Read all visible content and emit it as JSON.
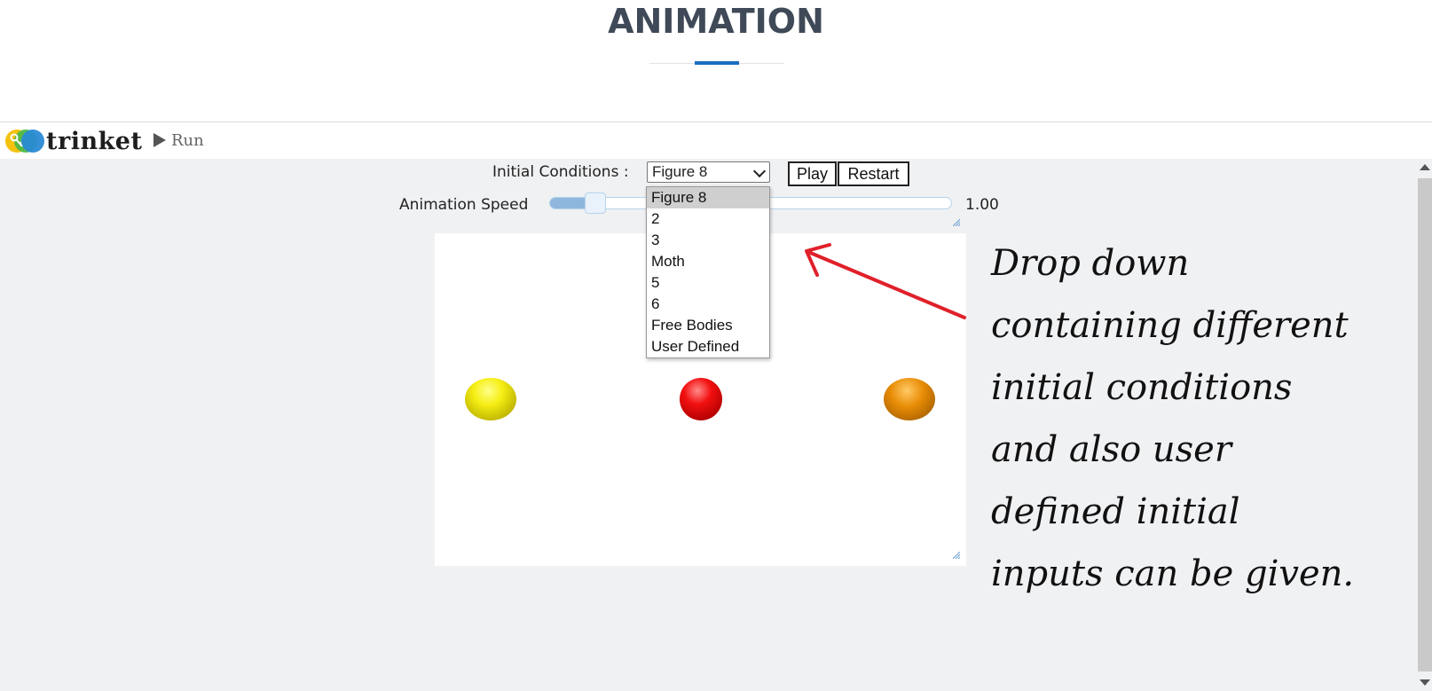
{
  "page": {
    "title": "ANIMATION"
  },
  "colors": {
    "accent": "#1b6ec2",
    "arrow": "#e0202a"
  },
  "trinket_bar": {
    "logo_text": "trinket",
    "run_label": "Run"
  },
  "controls": {
    "initial_conditions_label": "Initial Conditions :",
    "selected_condition": "Figure 8",
    "play_label": "Play",
    "restart_label": "Restart",
    "speed_label": "Animation Speed",
    "speed_value": "1.00",
    "speed_fraction": 0.09
  },
  "dropdown": {
    "options": [
      "Figure 8",
      "2",
      "3",
      "Moth",
      "5",
      "6",
      "Free Bodies",
      "User Defined"
    ],
    "highlighted_index": 0
  },
  "canvas": {
    "balls": [
      {
        "name": "yellow",
        "color": "#f6ee14"
      },
      {
        "name": "red",
        "color": "#f21010"
      },
      {
        "name": "orange",
        "color": "#e88c06"
      }
    ]
  },
  "annotation": {
    "lines": [
      "Drop down",
      "containing different",
      "initial conditions",
      "and also user",
      "defined initial",
      "inputs can be given."
    ]
  }
}
